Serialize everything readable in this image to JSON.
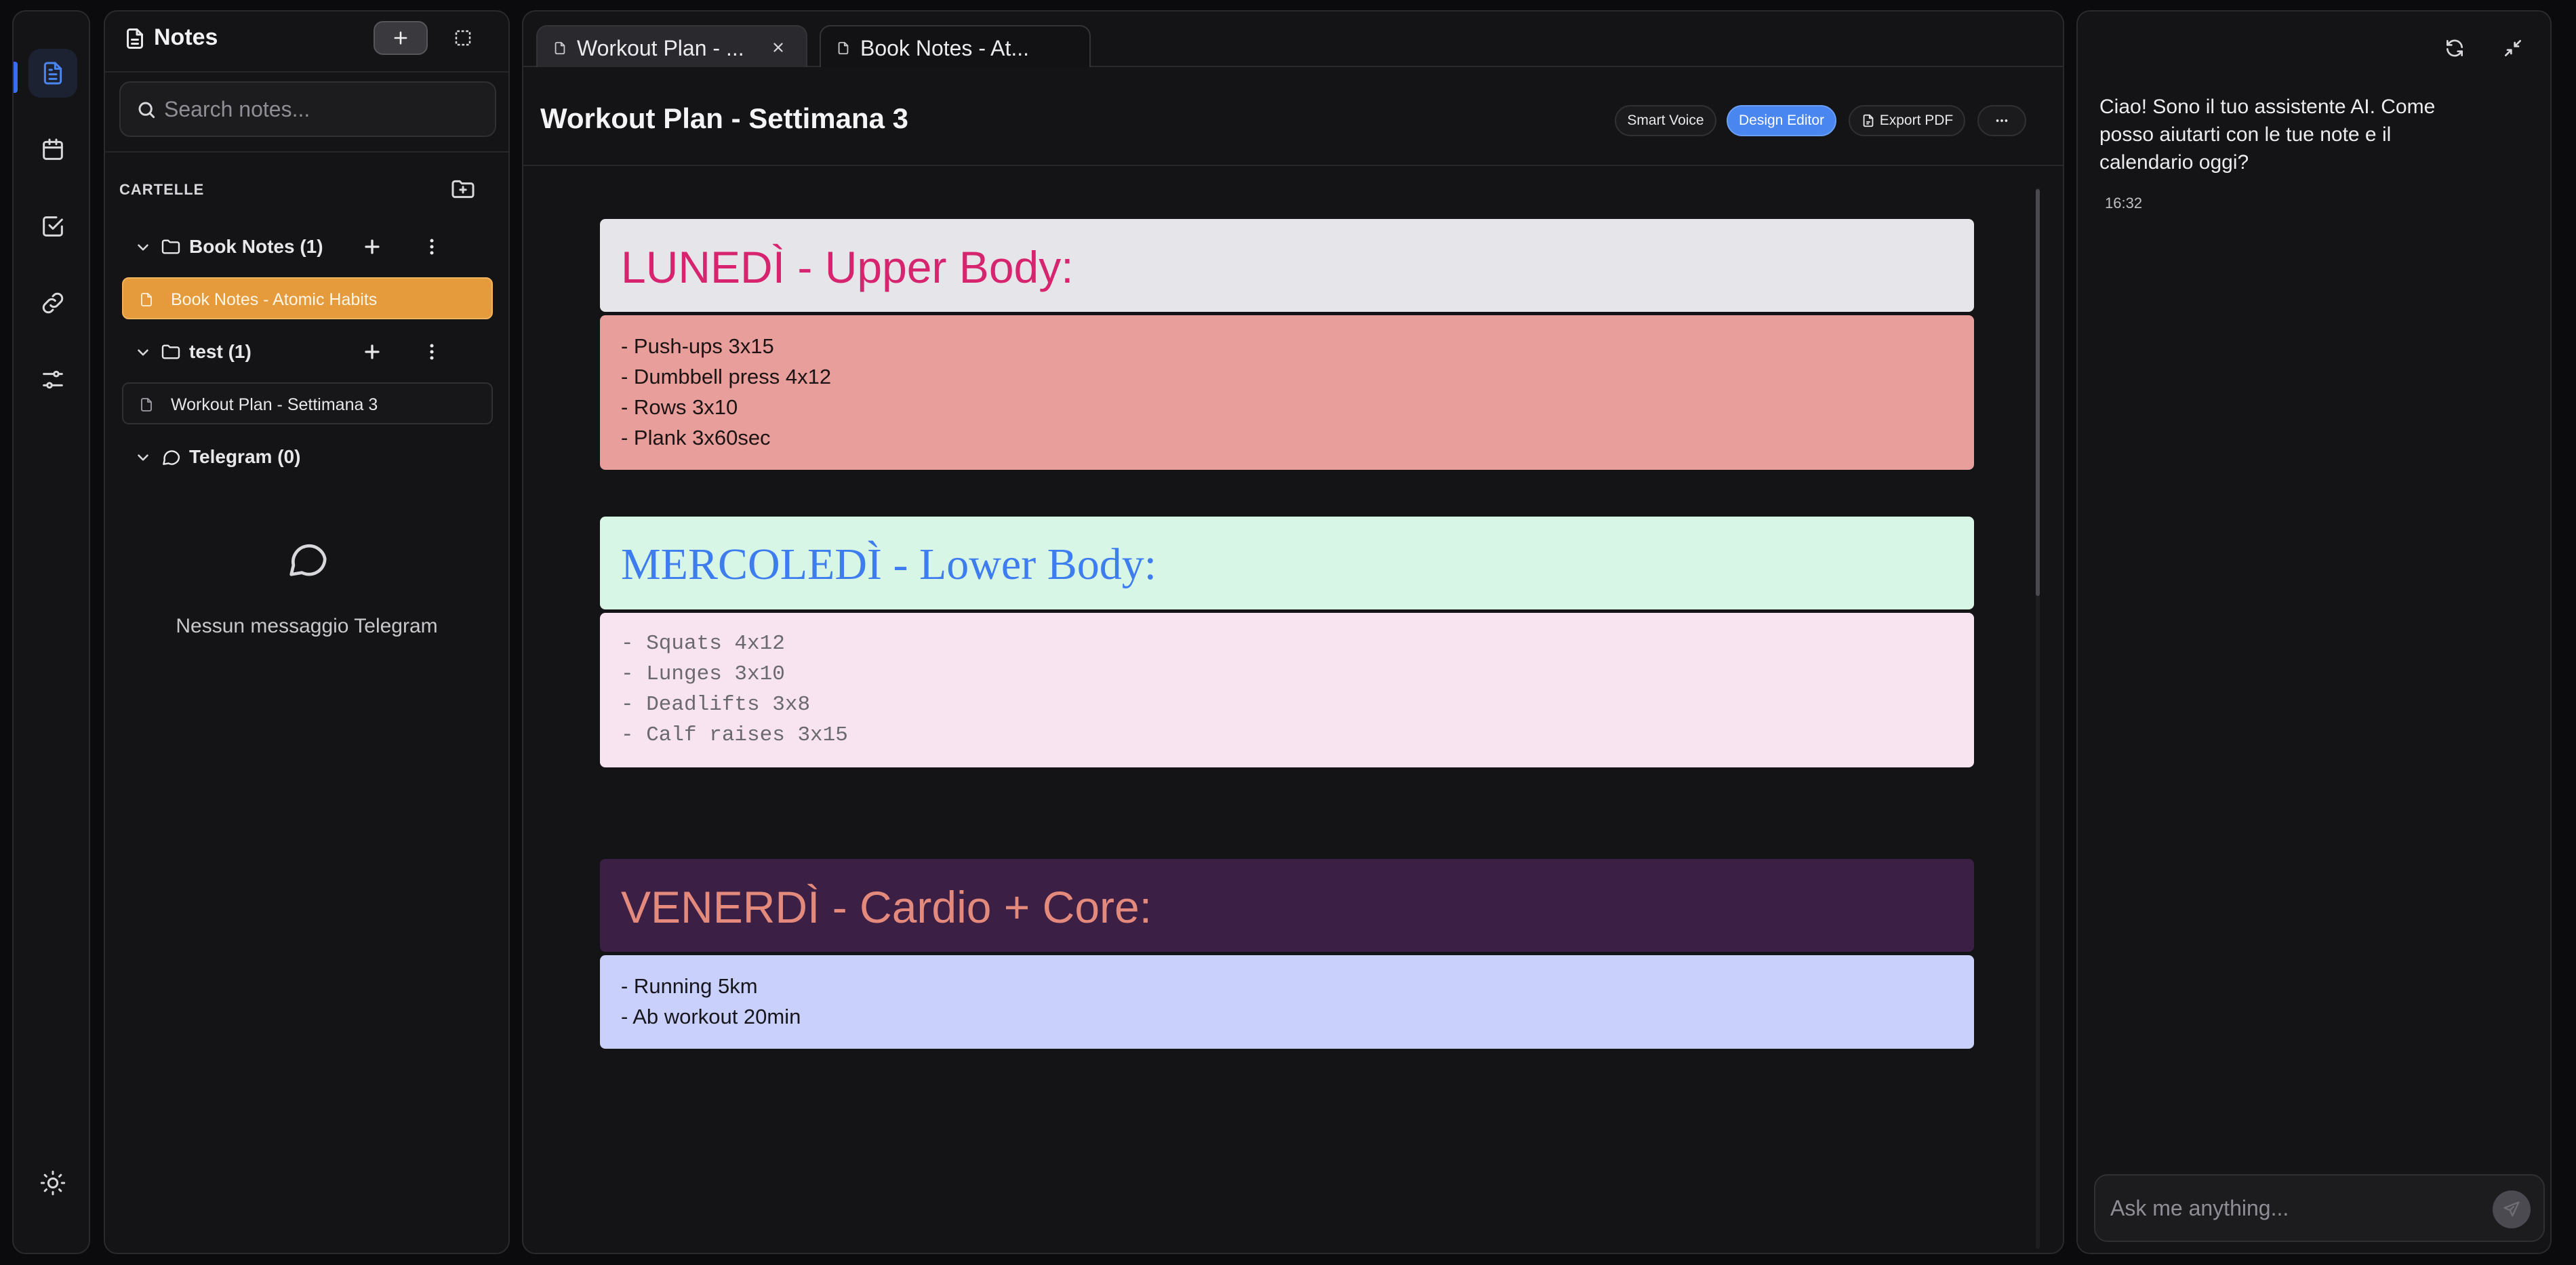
{
  "rail": {
    "items": [
      {
        "icon": "document-icon",
        "active": true
      },
      {
        "icon": "calendar-icon",
        "active": false
      },
      {
        "icon": "checkbox-icon",
        "active": false
      },
      {
        "icon": "link-icon",
        "active": false
      },
      {
        "icon": "sliders-icon",
        "active": false
      }
    ],
    "bottom_icon": "sun-icon"
  },
  "sidebar": {
    "title": "Notes",
    "search_placeholder": "Search notes...",
    "section_label": "CARTELLE",
    "folders": [
      {
        "label": "Book Notes (1)",
        "expanded": true,
        "notes": [
          {
            "label": "Book Notes - Atomic Habits",
            "active": true
          }
        ]
      },
      {
        "label": "test (1)",
        "expanded": true,
        "notes": [
          {
            "label": "Workout Plan - Settimana 3",
            "active": false
          }
        ]
      },
      {
        "label": "Telegram (0)",
        "expanded": true,
        "notes": []
      }
    ],
    "telegram_empty": "Nessun messaggio Telegram"
  },
  "tabs": [
    {
      "label": "Workout Plan - ...",
      "active": true
    },
    {
      "label": "Book Notes - At...",
      "active": false
    }
  ],
  "document": {
    "title": "Workout Plan - Settimana 3",
    "buttons": {
      "smart_voice": "Smart Voice",
      "design_editor": "Design Editor",
      "export_pdf": "Export PDF"
    },
    "blocks": [
      {
        "heading": "LUNEDÌ - Upper Body:",
        "heading_bg": "#e6e6ea",
        "heading_color": "#d6246e",
        "lines": [
          "- Push-ups 3x15",
          "- Dumbbell press 4x12",
          "- Rows 3x10",
          "- Plank 3x60sec"
        ],
        "body_bg": "#e89f9b",
        "body_color": "#1c1414"
      },
      {
        "heading": "MERCOLEDÌ - Lower Body:",
        "heading_bg": "#d8f6e6",
        "heading_color": "#3d7df0",
        "lines": [
          "- Squats 4x12",
          "- Lunges 3x10",
          "- Deadlifts 3x8",
          "- Calf raises 3x15"
        ],
        "body_bg": "#f8e4f1",
        "body_color": "#6a6a6e"
      },
      {
        "heading": "VENERDÌ - Cardio + Core:",
        "heading_bg": "#3c1f44",
        "heading_color": "#e38a7d",
        "lines": [
          "- Running 5km",
          "- Ab workout 20min"
        ],
        "body_bg": "#c9d0fb",
        "body_color": "#16161c"
      }
    ]
  },
  "assistant": {
    "message": "Ciao! Sono il tuo assistente AI. Come posso aiutarti con le tue note e il calendario oggi?",
    "time": "16:32",
    "input_placeholder": "Ask me anything..."
  },
  "colors": {
    "accent": "#4a86f0",
    "active_note": "#e59b3b"
  }
}
